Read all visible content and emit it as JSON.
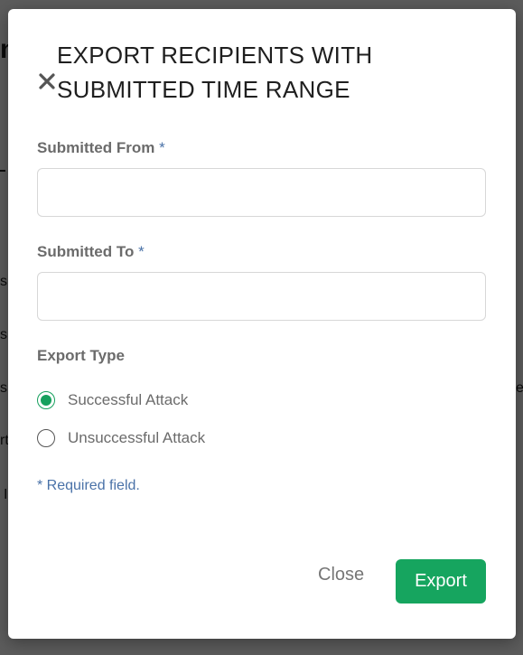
{
  "background": {
    "fragments": [
      "n",
      "s",
      "s",
      "s",
      "rt",
      "I",
      "ev"
    ]
  },
  "modal": {
    "title": "EXPORT RECIPIENTS WITH SUBMITTED TIME RANGE",
    "close_icon": "close-icon",
    "fields": [
      {
        "label": "Submitted From",
        "required_marker": "*",
        "value": "",
        "placeholder": ""
      },
      {
        "label": "Submitted To",
        "required_marker": "*",
        "value": "",
        "placeholder": ""
      }
    ],
    "export_type": {
      "label": "Export Type",
      "options": [
        {
          "label": "Successful Attack",
          "selected": true
        },
        {
          "label": "Unsuccessful Attack",
          "selected": false
        }
      ]
    },
    "required_note": "* Required field.",
    "buttons": {
      "close": "Close",
      "export": "Export"
    }
  },
  "colors": {
    "accent": "#16a55f",
    "required": "#4a72a8",
    "label": "#6b6b6b"
  }
}
